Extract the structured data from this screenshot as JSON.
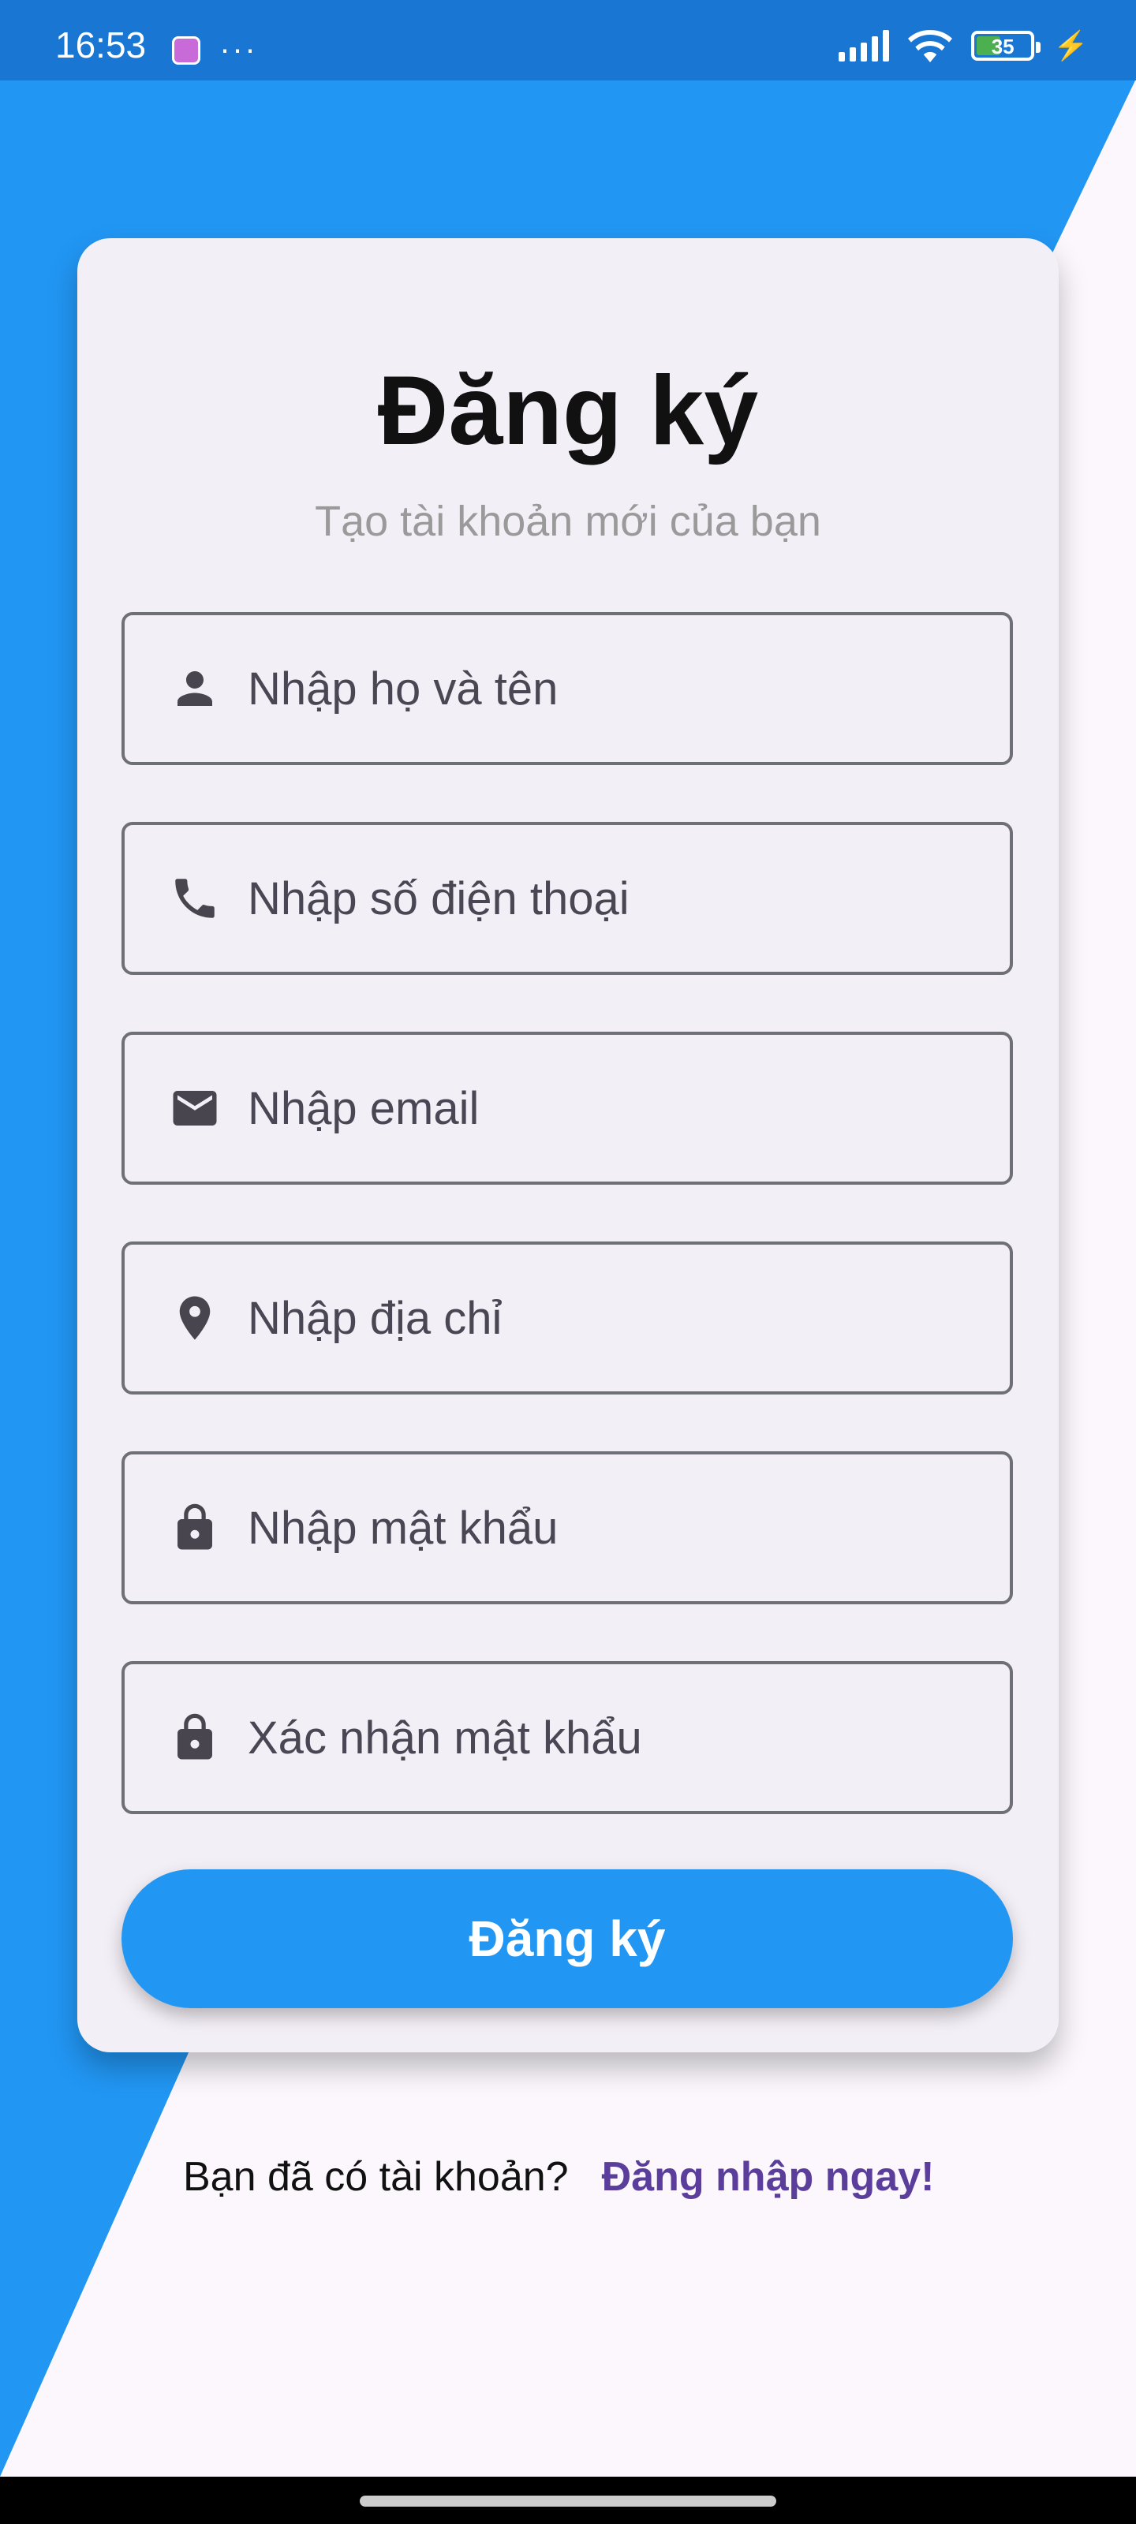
{
  "status_bar": {
    "time": "16:53",
    "dots": "···",
    "battery_level": "35",
    "icons": [
      "app-notification-icon",
      "signal-icon",
      "wifi-icon",
      "battery-icon",
      "charging-icon"
    ]
  },
  "form": {
    "title": "Đăng ký",
    "subtitle": "Tạo tài khoản mới của bạn",
    "fields": [
      {
        "placeholder": "Nhập họ và tên",
        "icon": "person-icon"
      },
      {
        "placeholder": "Nhập số điện thoại",
        "icon": "phone-icon"
      },
      {
        "placeholder": "Nhập email",
        "icon": "email-icon"
      },
      {
        "placeholder": "Nhập địa chỉ",
        "icon": "location-icon"
      },
      {
        "placeholder": "Nhập mật khẩu",
        "icon": "lock-icon"
      },
      {
        "placeholder": "Xác nhận mật khẩu",
        "icon": "lock-icon"
      }
    ],
    "submit_label": "Đăng ký"
  },
  "footer": {
    "prompt": "Bạn đã có tài khoản?",
    "link": "Đăng nhập ngay!"
  },
  "colors": {
    "primary": "#2196f3",
    "status_bar": "#1976d2",
    "link": "#5b3e9b",
    "card": "#f3eff6"
  }
}
